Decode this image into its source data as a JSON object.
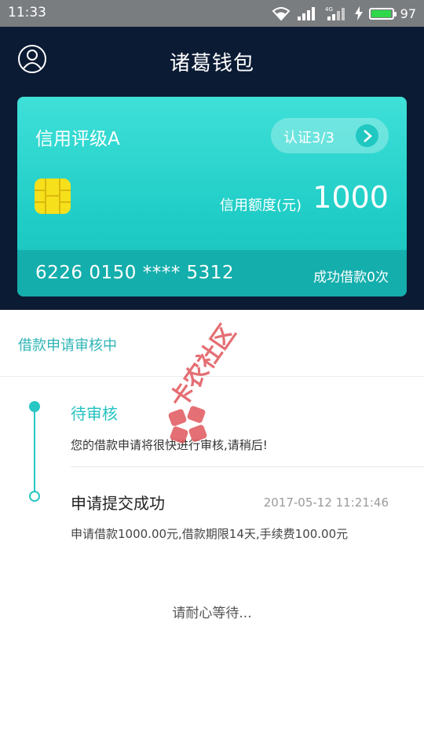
{
  "status_bar": {
    "time": "11:33",
    "network_label": "4G",
    "battery_percent": 97,
    "battery_text": "97",
    "colors": {
      "battery": "#2fd84a"
    }
  },
  "header": {
    "title": "诸葛钱包",
    "avatar_icon": "user-circle-icon"
  },
  "card": {
    "credit_rating": "信用评级A",
    "certification": "认证3/3",
    "chip_icon": "card-chip-icon",
    "limit_label": "信用额度(元)",
    "limit_value": "1000",
    "card_number": "6226 0150 **** 5312",
    "success_count": "成功借款0次",
    "colors": {
      "card_top": "#3fe0d8",
      "card_footer": "#14aeac",
      "accent": "#21c8c2"
    }
  },
  "loan_status": {
    "title": "借款申请审核中",
    "steps": [
      {
        "title": "待审核",
        "description": "您的借款申请将很快进行审核,请稍后!",
        "time": ""
      },
      {
        "title": "申请提交成功",
        "description": "申请借款1000.00元,借款期限14天,手续费100.00元",
        "time": "2017-05-12 11:21:46"
      }
    ],
    "wait_text": "请耐心等待..."
  },
  "watermark": {
    "text": "卡农社区"
  }
}
